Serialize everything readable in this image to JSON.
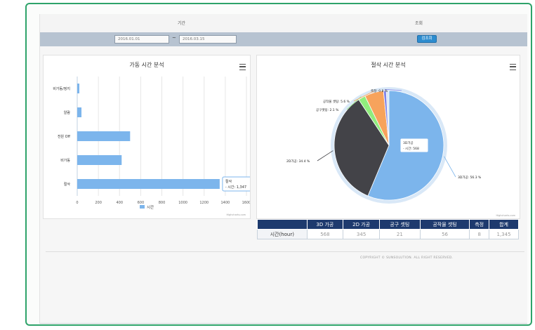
{
  "header": {
    "period_label": "기간",
    "search_label": "조회"
  },
  "filter": {
    "start_date": "2016.01.01",
    "separator": "~",
    "end_date": "2016.03.15",
    "search_button": "검조회"
  },
  "left_chart": {
    "title": "가동 시간 분석",
    "menu_icon": "hamburger-menu-icon",
    "credit": "Highcharts.com",
    "tooltip": {
      "line1": "절삭",
      "line2": "- 시간: 1,347"
    },
    "chart_data": {
      "type": "bar",
      "orientation": "horizontal",
      "categories": [
        "비가동/정지",
        "알람",
        "전원 Off",
        "비가동",
        "절삭"
      ],
      "series": [
        {
          "name": "시간",
          "values": [
            20,
            40,
            500,
            420,
            1347
          ],
          "color": "#7cb5ec"
        }
      ],
      "x_ticks": [
        "0",
        "200",
        "400",
        "600",
        "800",
        "1000",
        "1200",
        "1400",
        "1600"
      ],
      "xlim": [
        0,
        1600
      ],
      "legend": "bottom-center",
      "grid": true
    }
  },
  "right_chart": {
    "title": "절삭 시간 분석",
    "menu_icon": "hamburger-menu-icon",
    "credit": "Highcharts.com",
    "tooltip": {
      "line1": "3D가공",
      "line2": "- 시간: 568"
    },
    "chart_data": {
      "type": "pie",
      "slices": [
        {
          "name": "3D가공",
          "label": "3D가공: 56.3 %",
          "percent": 56.3,
          "color": "#7cb5ec"
        },
        {
          "name": "2D가공",
          "label": "2D가공: 34.4 %",
          "percent": 34.4,
          "color": "#434348"
        },
        {
          "name": "공구셋팅",
          "label": "공구셋팅: 2.1 %",
          "percent": 2.1,
          "color": "#90ed7d"
        },
        {
          "name": "공작물 셋팅",
          "label": "공작물 셋팅: 5.6 %",
          "percent": 5.6,
          "color": "#f7a35c"
        },
        {
          "name": "측정",
          "label": "측정: 0.8 %",
          "percent": 0.8,
          "color": "#8085e9"
        }
      ]
    }
  },
  "table": {
    "headers": [
      "",
      "3D 가공",
      "2D 가공",
      "공구 셋팅",
      "공작물 셋팅",
      "측정",
      "합계"
    ],
    "row_label": "시간(hour)",
    "values": [
      "568",
      "345",
      "21",
      "56",
      "8",
      "1,345"
    ]
  },
  "footer": {
    "copyright": "COPYRIGHT © SUNSOLUTION. ALL RIGHT RESERVED."
  }
}
